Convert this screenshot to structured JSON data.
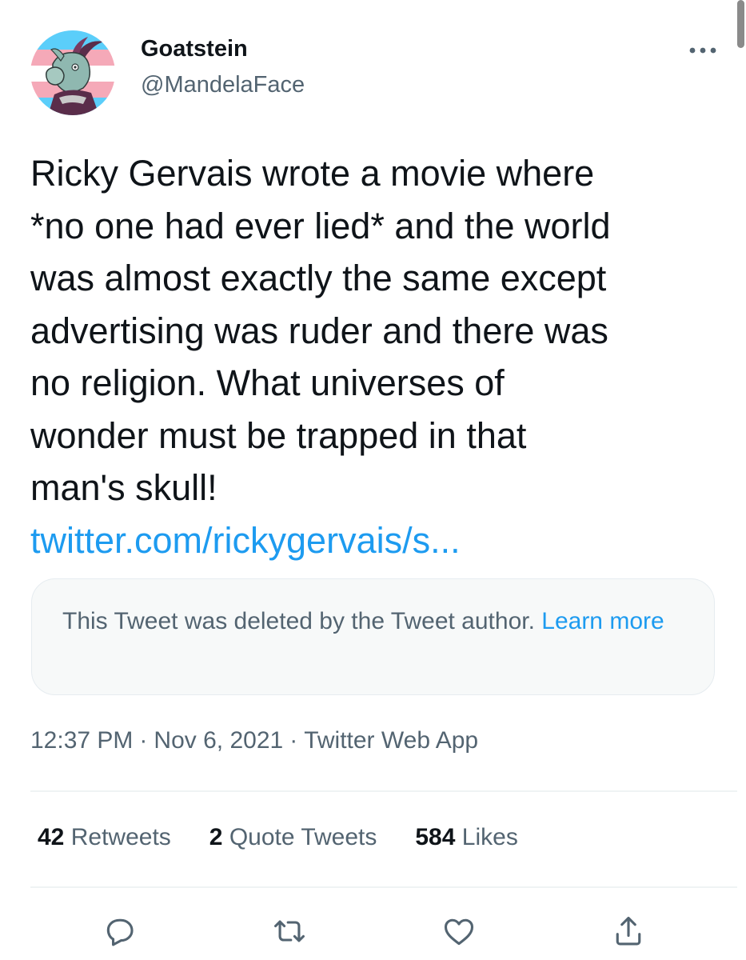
{
  "user": {
    "display_name": "Goatstein",
    "handle": "@MandelaFace",
    "avatar_icon": "goat-avatar"
  },
  "tweet": {
    "text_lines": [
      "Ricky Gervais wrote a movie where",
      "*no one had ever lied* and the world",
      "was almost exactly the same except",
      "advertising was ruder and there was",
      "no religion. What universes of",
      "wonder must be trapped in that",
      "man's skull!"
    ],
    "link": "twitter.com/rickygervais/s..."
  },
  "quoted_tweet": {
    "message": "This Tweet was deleted by the Tweet author.",
    "learn_more": "Learn more"
  },
  "meta": {
    "time": "12:37 PM",
    "separator": "·",
    "date": "Nov 6, 2021",
    "source": "Twitter Web App"
  },
  "stats": {
    "retweets_count": "42",
    "retweets_label": "Retweets",
    "quotes_count": "2",
    "quotes_label": "Quote Tweets",
    "likes_count": "584",
    "likes_label": "Likes"
  },
  "actions": [
    "reply-icon",
    "retweet-icon",
    "like-icon",
    "share-icon"
  ],
  "colors": {
    "accent": "#1d9bf0",
    "text": "#0f1419",
    "secondary_text": "#536471",
    "border": "#eff3f4"
  }
}
